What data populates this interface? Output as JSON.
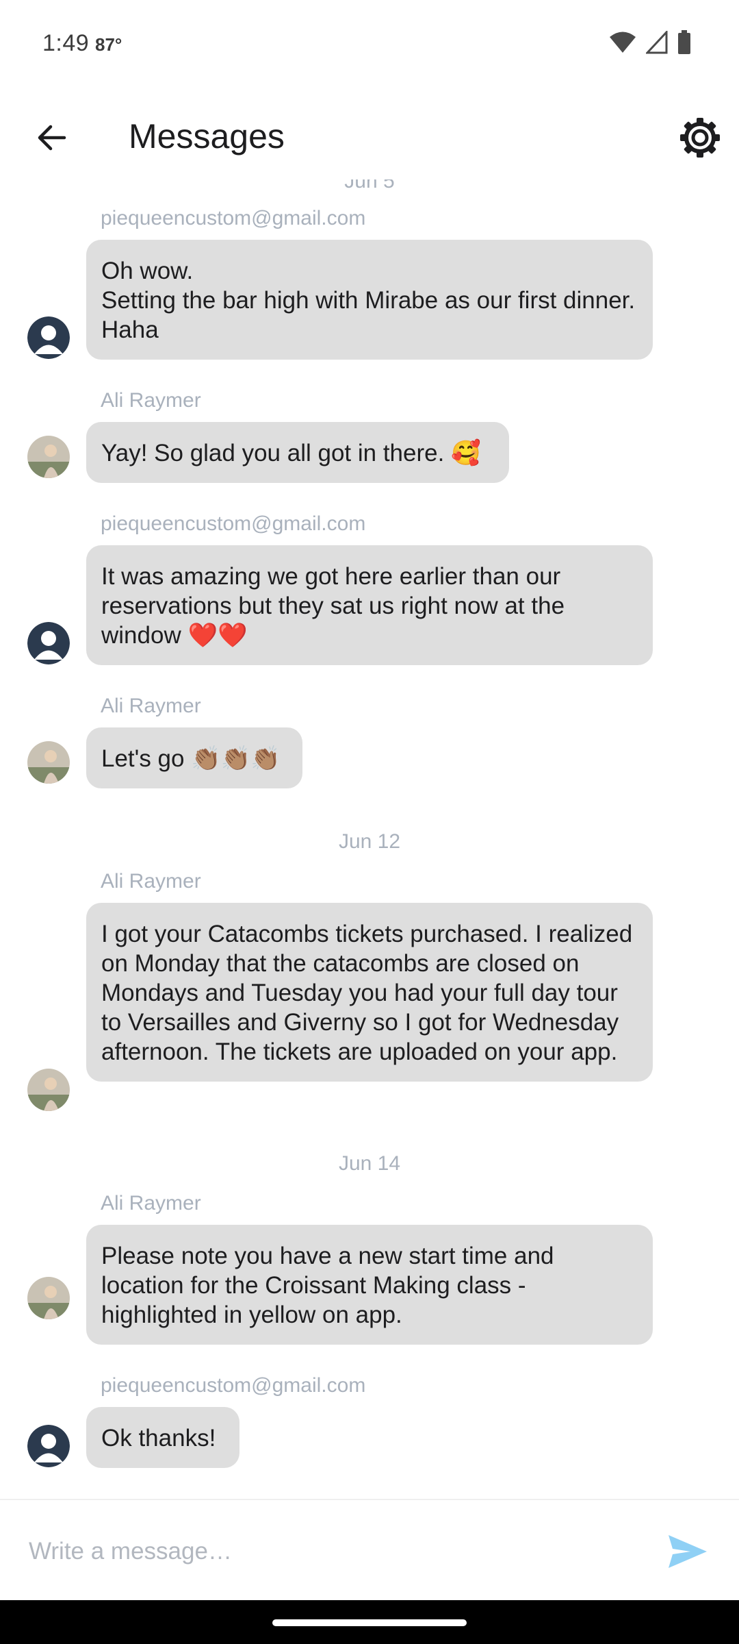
{
  "status_bar": {
    "time": "1:49",
    "temperature": "87°"
  },
  "header": {
    "title": "Messages",
    "back_icon": "arrow-left-icon",
    "settings_icon": "gear-icon"
  },
  "top_partial_date": "Jun 5",
  "messages": [
    {
      "sender": "piequeencustom@gmail.com",
      "text": "Oh wow.\nSetting the bar high with Mirabe as our first dinner. Haha",
      "avatar": "default-user"
    },
    {
      "sender": "Ali Raymer",
      "text": "Yay! So glad you all got in there. 🥰",
      "avatar": "photo"
    },
    {
      "sender": "piequeencustom@gmail.com",
      "text": "It was amazing we got here earlier than our reservations but they sat us right now at the window ❤️❤️",
      "avatar": "default-user"
    },
    {
      "sender": "Ali Raymer",
      "text": "Let's go 👏🏽👏🏽👏🏽",
      "avatar": "photo"
    },
    {
      "date": "Jun 12"
    },
    {
      "sender": "Ali Raymer",
      "text": "I got your Catacombs tickets purchased. I realized on Monday that the catacombs are closed on Mondays and Tuesday you had your full day tour to Versailles and Giverny so I got for Wednesday afternoon. The tickets are uploaded on your app.",
      "avatar": "photo"
    },
    {
      "date": "Jun 14"
    },
    {
      "sender": "Ali Raymer",
      "text": "Please note you have a new start time and location for the Croissant Making class - highlighted in yellow on app.",
      "avatar": "photo"
    },
    {
      "sender": "piequeencustom@gmail.com",
      "text": "Ok thanks!",
      "avatar": "default-user"
    }
  ],
  "composer": {
    "placeholder": "Write a message…",
    "send_icon": "send-icon"
  },
  "colors": {
    "bubble": "#dedede",
    "meta_text": "#a9b1bc",
    "send_accent": "#8fd0f5",
    "avatar_default": "#2b3a4e"
  }
}
